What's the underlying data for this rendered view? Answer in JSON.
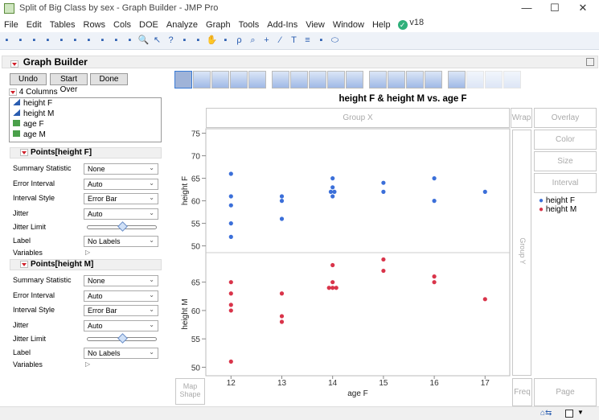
{
  "window": {
    "title": "Split of Big Class by sex - Graph Builder - JMP Pro",
    "minimize": "—",
    "maximize": "☐",
    "close": "✕"
  },
  "menu": [
    "File",
    "Edit",
    "Tables",
    "Rows",
    "Cols",
    "DOE",
    "Analyze",
    "Graph",
    "Tools",
    "Add-Ins",
    "View",
    "Window",
    "Help"
  ],
  "version": "v18",
  "toolbar_icons": [
    "new-data-table",
    "new-script",
    "python",
    "open",
    "save",
    "cut",
    "copy",
    "paste",
    "show-log",
    "lock",
    "search",
    "arrow",
    "help",
    "crosshair",
    "target",
    "hand",
    "brush",
    "lasso",
    "magnifier",
    "plus",
    "line",
    "text",
    "lines",
    "polygon",
    "ellipse"
  ],
  "panel": {
    "title": "Graph Builder",
    "undo": "Undo",
    "start_over": "Start Over",
    "done": "Done",
    "columns_label": "4 Columns",
    "columns": [
      {
        "name": "height F",
        "type": "continuous"
      },
      {
        "name": "height M",
        "type": "continuous"
      },
      {
        "name": "age F",
        "type": "ordinal"
      },
      {
        "name": "age M",
        "type": "ordinal"
      }
    ],
    "sections": [
      {
        "title": "Points[height F]",
        "summary_label": "Summary Statistic",
        "summary": "None",
        "error_label": "Error Interval",
        "error": "Auto",
        "style_label": "Interval Style",
        "style": "Error Bar",
        "jitter_label": "Jitter",
        "jitter": "Auto",
        "jitter_limit_label": "Jitter Limit",
        "jitter_limit": 0.5,
        "label_label": "Label",
        "label": "No Labels",
        "variables_label": "Variables"
      },
      {
        "title": "Points[height M]",
        "summary_label": "Summary Statistic",
        "summary": "None",
        "error_label": "Error Interval",
        "error": "Auto",
        "style_label": "Interval Style",
        "style": "Error Bar",
        "jitter_label": "Jitter",
        "jitter": "Auto",
        "jitter_limit_label": "Jitter Limit",
        "jitter_limit": 0.5,
        "label_label": "Label",
        "label": "No Labels",
        "variables_label": "Variables"
      }
    ]
  },
  "zones": {
    "group_x": "Group X",
    "wrap": "Wrap",
    "overlay": "Overlay",
    "color": "Color",
    "size": "Size",
    "interval": "Interval",
    "group_y": "Group Y",
    "map_shape": "Map Shape",
    "freq": "Freq",
    "page": "Page"
  },
  "colors": {
    "F": "#3b6fd9",
    "M": "#d9344a"
  },
  "chart_data": {
    "type": "scatter",
    "title": "height F & height M vs. age F",
    "xlabel": "age F",
    "x_ticks": [
      12,
      13,
      14,
      15,
      16,
      17
    ],
    "panels": [
      {
        "ylabel": "height F",
        "ylim": [
          48.5,
          76
        ],
        "y_ticks": [
          50,
          55,
          60,
          65,
          70,
          75
        ],
        "legend": "height F",
        "color": "#3b6fd9",
        "points": [
          [
            12,
            66
          ],
          [
            12,
            61
          ],
          [
            12,
            59
          ],
          [
            12,
            55
          ],
          [
            12,
            52
          ],
          [
            13,
            61
          ],
          [
            13,
            60
          ],
          [
            13,
            56
          ],
          [
            14,
            65
          ],
          [
            14,
            63
          ],
          [
            14,
            62
          ],
          [
            14,
            62
          ],
          [
            14,
            61
          ],
          [
            15,
            64
          ],
          [
            15,
            62
          ],
          [
            16,
            65
          ],
          [
            16,
            60
          ],
          [
            17,
            62
          ]
        ]
      },
      {
        "ylabel": "height M",
        "ylim": [
          48.5,
          70.2
        ],
        "y_ticks": [
          50,
          55,
          60,
          65
        ],
        "legend": "height M",
        "color": "#d9344a",
        "points": [
          [
            12,
            65
          ],
          [
            12,
            63
          ],
          [
            12,
            61
          ],
          [
            12,
            60
          ],
          [
            12,
            51
          ],
          [
            13,
            63
          ],
          [
            13,
            59
          ],
          [
            13,
            58
          ],
          [
            14,
            68
          ],
          [
            14,
            65
          ],
          [
            14,
            64
          ],
          [
            14,
            64
          ],
          [
            14,
            64
          ],
          [
            15,
            69
          ],
          [
            15,
            67
          ],
          [
            16,
            66
          ],
          [
            16,
            65
          ],
          [
            17,
            62
          ]
        ]
      }
    ]
  }
}
